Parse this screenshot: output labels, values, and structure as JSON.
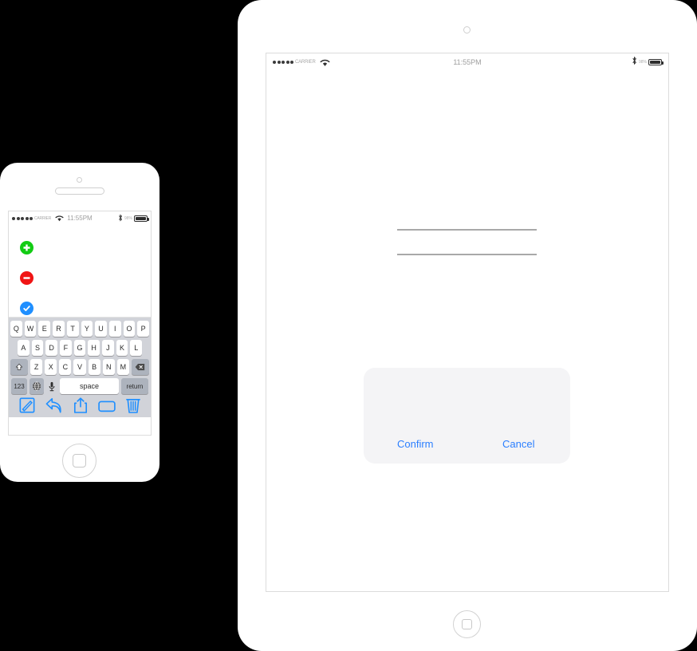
{
  "scene": {
    "background_color": "#000000",
    "devices": [
      "iphone",
      "ipad"
    ]
  },
  "colors": {
    "accent_blue": "#2b7fff",
    "add_green": "#12cc14",
    "remove_red": "#f01414",
    "confirm_blue": "#1f8fff",
    "keyboard_bg": "#d1d3d9",
    "key_bg": "#ffffff",
    "key_dark_bg": "#adb3bd",
    "alert_bg": "#f4f4f6",
    "field_line": "#a9a9a9"
  },
  "iphone": {
    "device_name": "iPhone",
    "status_bar": {
      "signal_dots": 5,
      "carrier": "CARRIER",
      "wifi_icon": "wifi-icon",
      "time": "11:55PM",
      "bluetooth_icon": "bluetooth-icon",
      "battery_percent": "98%",
      "battery_icon": "battery-icon"
    },
    "content": {
      "items": [
        {
          "icon": "add-circle-icon",
          "glyph": "+",
          "color": "#12cc14",
          "label": "add"
        },
        {
          "icon": "remove-circle-icon",
          "glyph": "−",
          "color": "#f01414",
          "label": "remove"
        },
        {
          "icon": "check-circle-icon",
          "glyph": "✓",
          "color": "#1f8fff",
          "label": "done"
        }
      ]
    },
    "keyboard": {
      "row1": [
        "Q",
        "W",
        "E",
        "R",
        "T",
        "Y",
        "U",
        "I",
        "O",
        "P"
      ],
      "row2": [
        "A",
        "S",
        "D",
        "F",
        "G",
        "H",
        "J",
        "K",
        "L"
      ],
      "row3": [
        "Z",
        "X",
        "C",
        "V",
        "B",
        "N",
        "M"
      ],
      "shift_label": "shift-key",
      "backspace_label": "backspace-key",
      "numbers_key": "123",
      "globe_key": "globe-key",
      "mic_key": "microphone-key",
      "space_key": "space",
      "return_key": "return"
    },
    "toolbar": {
      "items": [
        {
          "name": "compose-icon",
          "label": "Compose"
        },
        {
          "name": "reply-icon",
          "label": "Reply"
        },
        {
          "name": "share-icon",
          "label": "Share"
        },
        {
          "name": "folder-icon",
          "label": "Folder"
        },
        {
          "name": "trash-icon",
          "label": "Trash"
        }
      ]
    },
    "home_button": "home-button"
  },
  "ipad": {
    "device_name": "iPad",
    "status_bar": {
      "signal_dots": 5,
      "carrier": "CARRIER",
      "wifi_icon": "wifi-icon",
      "time": "11:55PM",
      "bluetooth_icon": "bluetooth-icon",
      "battery_percent": "98%",
      "battery_icon": "battery-icon"
    },
    "form": {
      "field_lines": 2
    },
    "alert": {
      "title": "",
      "message": "",
      "confirm_label": "Confirm",
      "cancel_label": "Cancel"
    },
    "home_button": "home-button"
  }
}
